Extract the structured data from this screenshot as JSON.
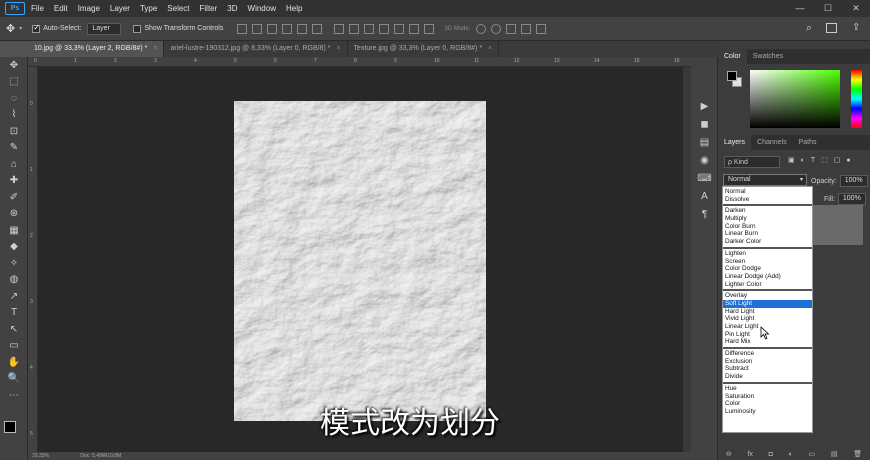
{
  "menu": {
    "items": [
      "File",
      "Edit",
      "Image",
      "Layer",
      "Type",
      "Select",
      "Filter",
      "3D",
      "Window",
      "Help"
    ],
    "logo": "Ps",
    "window_controls": [
      "—",
      "☐",
      "✕"
    ]
  },
  "options_bar": {
    "auto_select_label": "Auto-Select:",
    "auto_select_value": "Layer",
    "show_transform_label": "Show Transform Controls",
    "mode_3d_label": "3D Mode:"
  },
  "doc_tabs": [
    {
      "label": "10.jpg @ 33,3% (Layer 2, RGB/8#) *",
      "active": true
    },
    {
      "label": "ariel-lustre-190312.jpg @ 8,33% (Layer 0, RGB/8) *",
      "active": false
    },
    {
      "label": "Texture.jpg @ 33,3% (Layer 0, RGB/8#) *",
      "active": false
    }
  ],
  "tabs_close": "×",
  "tools": [
    "✥",
    "⬚",
    "◌",
    "⌇",
    "⊡",
    "✎",
    "⌂",
    "✚",
    "✐",
    "⊛",
    "▦",
    "◆",
    "✧",
    "◍",
    "↗",
    "T",
    "↖",
    "▭",
    "✋",
    "🔍",
    "⋯"
  ],
  "ruler": {
    "top": [
      "0",
      "1",
      "2",
      "3",
      "4",
      "5",
      "6",
      "7",
      "8",
      "9",
      "10",
      "11",
      "12",
      "13",
      "14",
      "15",
      "16"
    ],
    "left": [
      "0",
      "1",
      "2",
      "3",
      "4",
      "5"
    ]
  },
  "status": {
    "zoom": "33,33%",
    "doc": "Doc: 5,49M/10,8M"
  },
  "subtitle": "模式改为划分",
  "color_panel": {
    "tabs": [
      "Color",
      "Swatches"
    ]
  },
  "layers_panel": {
    "tabs": [
      "Layers",
      "Channels",
      "Paths"
    ],
    "kind_label": "ρ Kind",
    "blend_mode": "Normal",
    "opacity_label": "Opacity:",
    "opacity_value": "100%",
    "fill_label": "Fill:",
    "fill_value": "100%"
  },
  "blend_groups": [
    [
      "Normal",
      "Dissolve"
    ],
    [
      "Darken",
      "Multiply",
      "Color Burn",
      "Linear Burn",
      "Darker Color"
    ],
    [
      "Lighten",
      "Screen",
      "Color Dodge",
      "Linear Dodge (Add)",
      "Lighter Color"
    ],
    [
      "Overlay",
      "Soft Light",
      "Hard Light",
      "Vivid Light",
      "Linear Light",
      "Pin Light",
      "Hard Mix"
    ],
    [
      "Difference",
      "Exclusion",
      "Subtract",
      "Divide"
    ],
    [
      "Hue",
      "Saturation",
      "Color",
      "Luminosity"
    ]
  ],
  "selected_blend": "Soft Light",
  "panel_bottom_icons": [
    "⊖",
    "fx",
    "◘",
    "◐",
    "▭",
    "▤",
    "🗑"
  ],
  "icon_column": [
    "▶",
    "◼",
    "▤",
    "◉",
    "⌨",
    "A",
    "¶"
  ],
  "colors": {
    "accent": "#1e6ed8",
    "panel": "#3c3c3c",
    "canvas": "#282828",
    "chrome": "#535353"
  }
}
